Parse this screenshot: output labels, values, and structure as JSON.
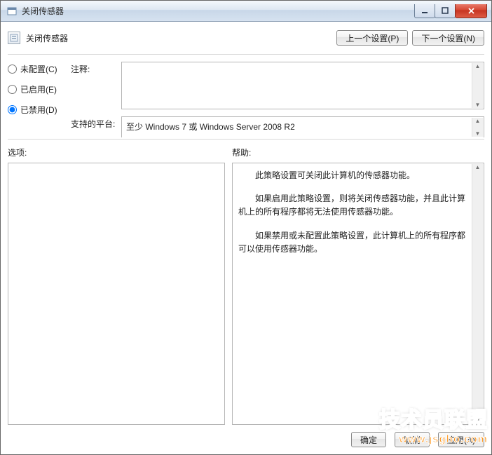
{
  "window": {
    "title": "关闭传感器"
  },
  "header": {
    "title": "关闭传感器",
    "prev_btn": "上一个设置(P)",
    "next_btn": "下一个设置(N)"
  },
  "radios": {
    "not_configured": "未配置(C)",
    "enabled": "已启用(E)",
    "disabled": "已禁用(D)",
    "selected": "disabled"
  },
  "fields": {
    "comment_label": "注释:",
    "comment_value": "",
    "platform_label": "支持的平台:",
    "platform_value": "至少 Windows 7 或 Windows Server 2008 R2"
  },
  "lower": {
    "options_label": "选项:",
    "help_label": "帮助:"
  },
  "help": {
    "p1": "此策略设置可关闭此计算机的传感器功能。",
    "p2": "如果启用此策略设置，则将关闭传感器功能，并且此计算机上的所有程序都将无法使用传感器功能。",
    "p3": "如果禁用或未配置此策略设置，此计算机上的所有程序都可以使用传感器功能。"
  },
  "footer": {
    "ok": "确定",
    "cancel": "取消",
    "apply": "应用(A)"
  },
  "watermark": {
    "line1": "技术员联盟",
    "line2": "www.jsgho.com"
  }
}
